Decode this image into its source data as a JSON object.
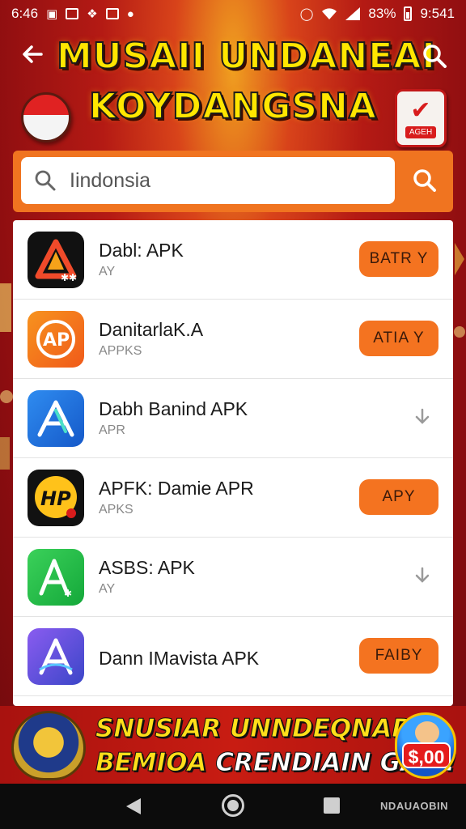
{
  "status_bar": {
    "time_left": "6:46",
    "battery_percent": "83%",
    "time_right": "9:541"
  },
  "header": {
    "title_line1": "MUSAII UNDANEAI",
    "title_line2": "KOYDANGSNA",
    "badge_right_tag": "AGEH"
  },
  "search": {
    "value": "Iindonsia",
    "placeholder": "Iindonsia"
  },
  "apps": [
    {
      "name": "Dabl: APK",
      "subtitle": "AY",
      "action": "BATR Y",
      "icon": "red-triangle-app-icon"
    },
    {
      "name": "DanitarlaK.A",
      "subtitle": "APPKS",
      "action": "ATIA Y",
      "icon": "orange-ap-app-icon"
    },
    {
      "name": "Dabh Banind APK",
      "subtitle": "APR",
      "action": "",
      "icon": "blue-a-app-icon"
    },
    {
      "name": "APFK: Damie APR",
      "subtitle": "APKS",
      "action": "APY",
      "icon": "yellow-hp-app-icon"
    },
    {
      "name": "ASBS: APK",
      "subtitle": "AY",
      "action": "",
      "icon": "green-a-app-icon"
    },
    {
      "name": "Dann IMavista APK",
      "subtitle": "",
      "action": "FAIBY",
      "icon": "purple-a-app-icon"
    }
  ],
  "banner": {
    "line1": "SNUSIAR UNNDEQNAD",
    "line2_highlight": "BEMIOA",
    "line2_rest": " CRENDIAIN GAM!",
    "price": "$,00"
  },
  "nav_bar": {
    "label": "NDAUAOBIN"
  },
  "colors": {
    "accent_orange": "#f47320",
    "title_yellow": "#ffe600",
    "background_red": "#b41a14"
  }
}
